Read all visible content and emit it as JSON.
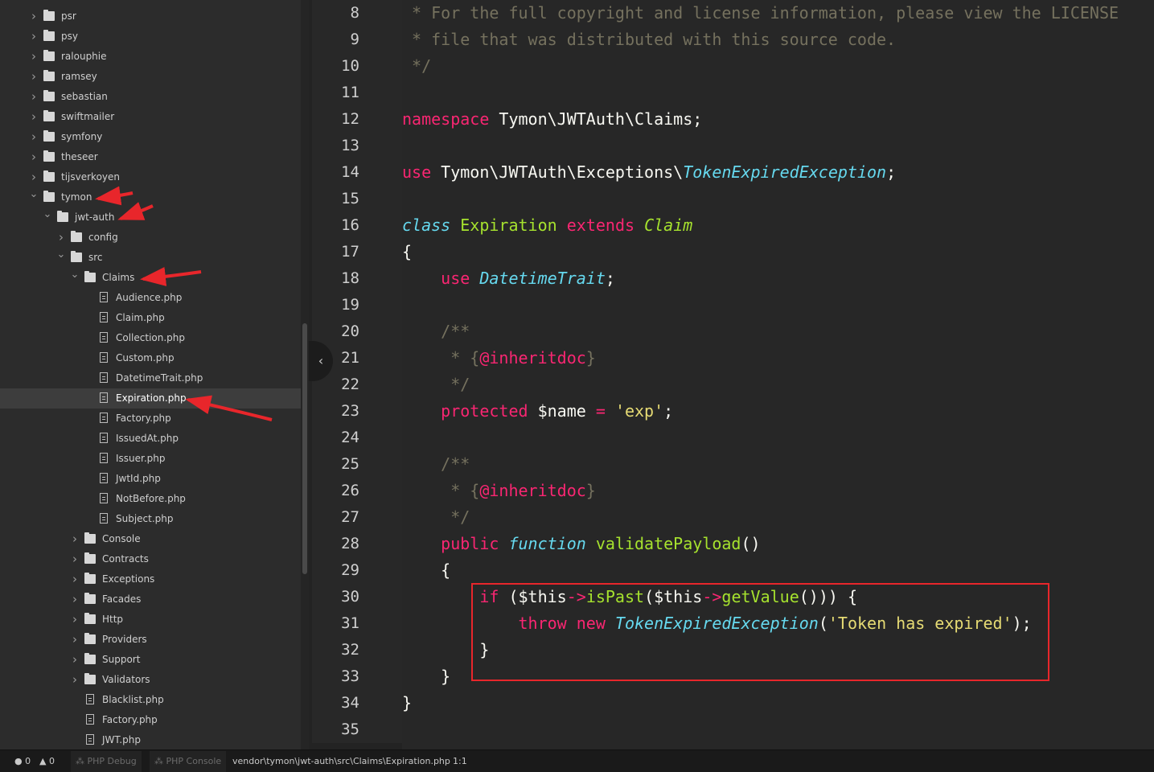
{
  "tree_view": {
    "items": [
      {
        "label": "psr",
        "type": "folder",
        "expanded": false,
        "depth": 0
      },
      {
        "label": "psy",
        "type": "folder",
        "expanded": false,
        "depth": 0
      },
      {
        "label": "ralouphie",
        "type": "folder",
        "expanded": false,
        "depth": 0
      },
      {
        "label": "ramsey",
        "type": "folder",
        "expanded": false,
        "depth": 0
      },
      {
        "label": "sebastian",
        "type": "folder",
        "expanded": false,
        "depth": 0
      },
      {
        "label": "swiftmailer",
        "type": "folder",
        "expanded": false,
        "depth": 0
      },
      {
        "label": "symfony",
        "type": "folder",
        "expanded": false,
        "depth": 0
      },
      {
        "label": "theseer",
        "type": "folder",
        "expanded": false,
        "depth": 0
      },
      {
        "label": "tijsverkoyen",
        "type": "folder",
        "expanded": false,
        "depth": 0
      },
      {
        "label": "tymon",
        "type": "folder",
        "expanded": true,
        "depth": 0
      },
      {
        "label": "jwt-auth",
        "type": "folder",
        "expanded": true,
        "depth": 1
      },
      {
        "label": "config",
        "type": "folder",
        "expanded": false,
        "depth": 2
      },
      {
        "label": "src",
        "type": "folder",
        "expanded": true,
        "depth": 2
      },
      {
        "label": "Claims",
        "type": "folder",
        "expanded": true,
        "depth": 3
      },
      {
        "label": "Audience.php",
        "type": "file",
        "depth": 4
      },
      {
        "label": "Claim.php",
        "type": "file",
        "depth": 4
      },
      {
        "label": "Collection.php",
        "type": "file",
        "depth": 4
      },
      {
        "label": "Custom.php",
        "type": "file",
        "depth": 4
      },
      {
        "label": "DatetimeTrait.php",
        "type": "file",
        "depth": 4
      },
      {
        "label": "Expiration.php",
        "type": "file",
        "depth": 4,
        "selected": true
      },
      {
        "label": "Factory.php",
        "type": "file",
        "depth": 4
      },
      {
        "label": "IssuedAt.php",
        "type": "file",
        "depth": 4
      },
      {
        "label": "Issuer.php",
        "type": "file",
        "depth": 4
      },
      {
        "label": "JwtId.php",
        "type": "file",
        "depth": 4
      },
      {
        "label": "NotBefore.php",
        "type": "file",
        "depth": 4
      },
      {
        "label": "Subject.php",
        "type": "file",
        "depth": 4
      },
      {
        "label": "Console",
        "type": "folder",
        "expanded": false,
        "depth": 3
      },
      {
        "label": "Contracts",
        "type": "folder",
        "expanded": false,
        "depth": 3
      },
      {
        "label": "Exceptions",
        "type": "folder",
        "expanded": false,
        "depth": 3
      },
      {
        "label": "Facades",
        "type": "folder",
        "expanded": false,
        "depth": 3
      },
      {
        "label": "Http",
        "type": "folder",
        "expanded": false,
        "depth": 3
      },
      {
        "label": "Providers",
        "type": "folder",
        "expanded": false,
        "depth": 3
      },
      {
        "label": "Support",
        "type": "folder",
        "expanded": false,
        "depth": 3
      },
      {
        "label": "Validators",
        "type": "folder",
        "expanded": false,
        "depth": 3
      },
      {
        "label": "Blacklist.php",
        "type": "file",
        "depth": 3
      },
      {
        "label": "Factory.php",
        "type": "file",
        "depth": 3
      },
      {
        "label": "JWT.php",
        "type": "file",
        "depth": 3
      }
    ]
  },
  "editor": {
    "first_line_number": 8,
    "lines": [
      [
        [
          "comment",
          " * For the full copyright and license information, please view the LICENSE"
        ]
      ],
      [
        [
          "comment",
          " * file that was distributed with this source code."
        ]
      ],
      [
        [
          "comment",
          " */"
        ]
      ],
      [],
      [
        [
          "keyword",
          "namespace"
        ],
        [
          "plain",
          " Tymon\\JWTAuth\\Claims;"
        ]
      ],
      [],
      [
        [
          "keyword",
          "use"
        ],
        [
          "plain",
          " Tymon\\JWTAuth\\Exceptions\\"
        ],
        [
          "ital",
          "TokenExpiredException"
        ],
        [
          "plain",
          ";"
        ]
      ],
      [],
      [
        [
          "storage",
          "class"
        ],
        [
          "plain",
          " "
        ],
        [
          "class",
          "Expiration"
        ],
        [
          "plain",
          " "
        ],
        [
          "keyword",
          "extends"
        ],
        [
          "plain",
          " "
        ],
        [
          "inherit",
          "Claim"
        ]
      ],
      [
        [
          "plain",
          "{"
        ]
      ],
      [
        [
          "plain",
          "    "
        ],
        [
          "keyword",
          "use"
        ],
        [
          "plain",
          " "
        ],
        [
          "ital",
          "DatetimeTrait"
        ],
        [
          "plain",
          ";"
        ]
      ],
      [],
      [
        [
          "comment",
          "    /**"
        ]
      ],
      [
        [
          "comment",
          "     * {"
        ],
        [
          "keyword",
          "@inheritdoc"
        ],
        [
          "comment",
          "}"
        ]
      ],
      [
        [
          "comment",
          "     */"
        ]
      ],
      [
        [
          "plain",
          "    "
        ],
        [
          "keyword",
          "protected"
        ],
        [
          "plain",
          " $name "
        ],
        [
          "keyword",
          "="
        ],
        [
          "plain",
          " "
        ],
        [
          "string",
          "'exp'"
        ],
        [
          "plain",
          ";"
        ]
      ],
      [],
      [
        [
          "comment",
          "    /**"
        ]
      ],
      [
        [
          "comment",
          "     * {"
        ],
        [
          "keyword",
          "@inheritdoc"
        ],
        [
          "comment",
          "}"
        ]
      ],
      [
        [
          "comment",
          "     */"
        ]
      ],
      [
        [
          "plain",
          "    "
        ],
        [
          "keyword",
          "public"
        ],
        [
          "plain",
          " "
        ],
        [
          "storage",
          "function"
        ],
        [
          "plain",
          " "
        ],
        [
          "fn",
          "validatePayload"
        ],
        [
          "plain",
          "()"
        ]
      ],
      [
        [
          "plain",
          "    {"
        ]
      ],
      [
        [
          "plain",
          "        "
        ],
        [
          "keyword",
          "if"
        ],
        [
          "plain",
          " ($this"
        ],
        [
          "keyword",
          "->"
        ],
        [
          "fn",
          "isPast"
        ],
        [
          "plain",
          "($this"
        ],
        [
          "keyword",
          "->"
        ],
        [
          "fn",
          "getValue"
        ],
        [
          "plain",
          "())) {"
        ]
      ],
      [
        [
          "plain",
          "            "
        ],
        [
          "keyword",
          "throw"
        ],
        [
          "plain",
          " "
        ],
        [
          "keyword",
          "new"
        ],
        [
          "plain",
          " "
        ],
        [
          "ital",
          "TokenExpiredException"
        ],
        [
          "plain",
          "("
        ],
        [
          "string",
          "'Token has expired'"
        ],
        [
          "plain",
          ");"
        ]
      ],
      [
        [
          "plain",
          "        }"
        ]
      ],
      [
        [
          "plain",
          "    }"
        ]
      ],
      [
        [
          "plain",
          "}"
        ]
      ],
      []
    ]
  },
  "collapse_handle": {
    "glyph": "‹"
  },
  "status_bar": {
    "error_count": "0",
    "warning_count": "0",
    "php_debug": "PHP Debug",
    "php_console": "PHP Console",
    "file_path": "vendor\\tymon\\jwt-auth\\src\\Claims\\Expiration.php",
    "cursor_position": "1:1"
  },
  "colors": {
    "annotation": "#e8262b",
    "keyword": "#f92672",
    "storage": "#66d9ef",
    "function": "#a6e22e",
    "string": "#e6db74",
    "comment": "#75715e"
  }
}
